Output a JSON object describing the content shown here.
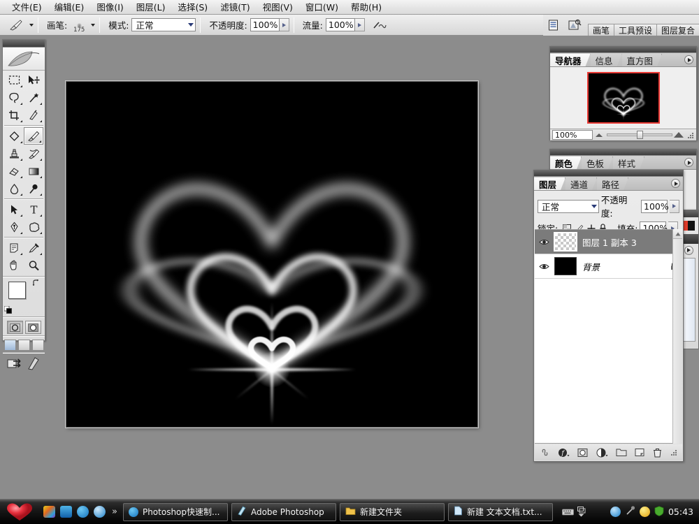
{
  "menubar": {
    "items": [
      {
        "label": "文件(E)",
        "name": "menu-file"
      },
      {
        "label": "编辑(E)",
        "name": "menu-edit"
      },
      {
        "label": "图像(I)",
        "name": "menu-image"
      },
      {
        "label": "图层(L)",
        "name": "menu-layer"
      },
      {
        "label": "选择(S)",
        "name": "menu-select"
      },
      {
        "label": "滤镜(T)",
        "name": "menu-filter"
      },
      {
        "label": "视图(V)",
        "name": "menu-view"
      },
      {
        "label": "窗口(W)",
        "name": "menu-window"
      },
      {
        "label": "帮助(H)",
        "name": "menu-help"
      }
    ]
  },
  "options_bar": {
    "brush_label": "画笔:",
    "brush_size": "175",
    "mode_label": "模式:",
    "mode_value": "正常",
    "opacity_label": "不透明度:",
    "opacity_value": "100%",
    "flow_label": "流量:",
    "flow_value": "100%",
    "airbrush_icon": "airbrush-icon",
    "tool_preset_icon": "brush-tool-icon"
  },
  "palette_well": {
    "dock_icon": "palette-dock-icon",
    "file_browser_icon": "file-browser-icon",
    "tabs": [
      "画笔",
      "工具预设",
      "图层复合"
    ]
  },
  "toolbox": {
    "tools": [
      {
        "name": "marquee-tool",
        "glyph": "marquee"
      },
      {
        "name": "move-tool",
        "glyph": "move"
      },
      {
        "name": "lasso-tool",
        "glyph": "lasso"
      },
      {
        "name": "magic-wand-tool",
        "glyph": "wand"
      },
      {
        "name": "crop-tool",
        "glyph": "crop"
      },
      {
        "name": "slice-tool",
        "glyph": "slice"
      },
      {
        "name": "healing-brush-tool",
        "glyph": "heal"
      },
      {
        "name": "brush-tool",
        "glyph": "brush"
      },
      {
        "name": "clone-stamp-tool",
        "glyph": "stamp"
      },
      {
        "name": "history-brush-tool",
        "glyph": "history"
      },
      {
        "name": "eraser-tool",
        "glyph": "eraser"
      },
      {
        "name": "gradient-tool",
        "glyph": "gradient"
      },
      {
        "name": "blur-tool",
        "glyph": "blur"
      },
      {
        "name": "dodge-tool",
        "glyph": "dodge"
      },
      {
        "name": "path-selection-tool",
        "glyph": "arrow"
      },
      {
        "name": "type-tool",
        "glyph": "type"
      },
      {
        "name": "pen-tool",
        "glyph": "pen"
      },
      {
        "name": "shape-tool",
        "glyph": "shape"
      },
      {
        "name": "notes-tool",
        "glyph": "notes"
      },
      {
        "name": "eyedropper-tool",
        "glyph": "eyedropper"
      },
      {
        "name": "hand-tool",
        "glyph": "hand"
      },
      {
        "name": "zoom-tool",
        "glyph": "zoom"
      }
    ],
    "selected_tool": "brush-tool",
    "foreground_color": "#ffffff",
    "background_color": "#000000",
    "quick_mask_modes": [
      "standard-mode",
      "quick-mask-mode"
    ],
    "screen_modes": [
      "standard-screen-mode",
      "full-screen-menubar-mode",
      "full-screen-mode"
    ],
    "jump_to_label": "jump-to-imageready"
  },
  "navigator": {
    "tabs": [
      "导航器",
      "信息",
      "直方图"
    ],
    "active_tab": "导航器",
    "zoom_value": "100%",
    "view_box_color": "#ea3b36"
  },
  "color_panel": {
    "tabs": [
      "颜色",
      "色板",
      "样式"
    ],
    "active_tab": "颜色"
  },
  "layers_panel": {
    "tabs": [
      "图层",
      "通道",
      "路径"
    ],
    "active_tab": "图层",
    "blend_mode": "正常",
    "opacity_label": "不透明度:",
    "opacity_value": "100%",
    "lock_label": "锁定:",
    "lock_icons": [
      "lock-transparent-pixels-icon",
      "lock-image-pixels-icon",
      "lock-position-icon",
      "lock-all-icon"
    ],
    "fill_label": "填充:",
    "fill_value": "100%",
    "layers": [
      {
        "name": "图层 1 副本 3",
        "visible": true,
        "selected": true,
        "locked": false,
        "thumb": "checker"
      },
      {
        "name": "背景",
        "visible": true,
        "selected": false,
        "locked": true,
        "thumb": "black"
      }
    ],
    "footer_icons": [
      "link-layers-icon",
      "layer-style-icon",
      "layer-mask-icon",
      "adjustment-layer-icon",
      "new-group-icon",
      "new-layer-icon",
      "delete-layer-icon"
    ]
  },
  "document": {
    "artwork_background": "#000000",
    "artwork_title": "glowing-hearts-artwork"
  },
  "taskbar": {
    "start_button": "heart-start-button",
    "quick_launch": [
      {
        "name": "ql-colorful-icon",
        "color": "#d86030"
      },
      {
        "name": "ql-editor-icon",
        "color": "#1f7fd0"
      },
      {
        "name": "ql-maxthon-icon",
        "color": "#1f8ad0"
      },
      {
        "name": "ql-kingsoft-icon",
        "color": "#1a7fc8"
      }
    ],
    "chevron": "»",
    "windows": [
      {
        "label": "Photoshop快速制...",
        "icon": "maxthon-icon"
      },
      {
        "label": "Adobe Photoshop",
        "icon": "photoshop-icon"
      },
      {
        "label": "新建文件夹",
        "icon": "folder-icon"
      },
      {
        "label": "新建 文本文档.txt...",
        "icon": "text-file-icon"
      }
    ],
    "lang_icons": [
      "keyboard-icon",
      "ime-switch-icon"
    ],
    "tray_icons": [
      {
        "name": "kingsoft-tray-icon",
        "color": "#1b7fc9"
      },
      {
        "name": "tool-tray-icon",
        "color": "#8f8f8f"
      },
      {
        "name": "antivirus-tray-icon",
        "color": "#f0c020"
      },
      {
        "name": "shield-tray-icon",
        "color": "#4caa2e"
      }
    ],
    "clock": "05:43"
  },
  "colors": {
    "desktop": "#8c8c8c",
    "panel_face": "#e8e8e8",
    "selected_layer": "#7b7b7b",
    "accent_red": "#ea3b36"
  }
}
